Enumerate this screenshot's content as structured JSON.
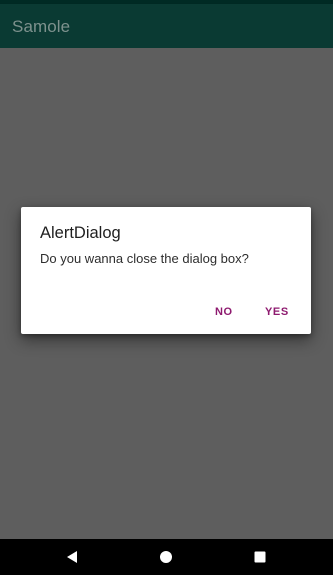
{
  "app_bar": {
    "title": "Samole"
  },
  "dialog": {
    "title": "AlertDialog",
    "message": "Do you wanna close the dialog box?",
    "negative_label": "NO",
    "positive_label": "YES"
  },
  "navigation": {
    "back_icon": "back-triangle-icon",
    "home_icon": "home-circle-icon",
    "recents_icon": "recents-square-icon"
  },
  "colors": {
    "app_bar": "#0a3a33",
    "status_bar": "#002a24",
    "scrim_background": "#5e5e5e",
    "dialog_button_accent": "#8e1a6f",
    "navigation_bar": "#000000"
  }
}
